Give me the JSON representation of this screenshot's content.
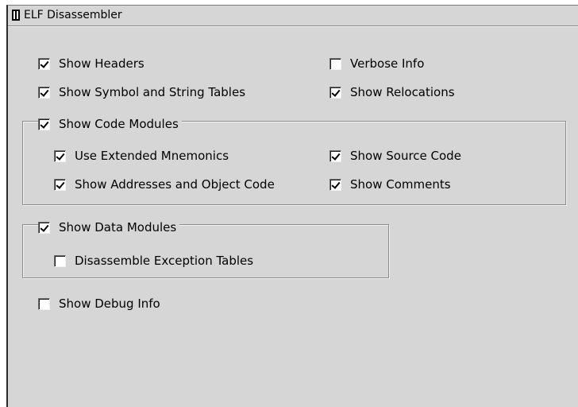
{
  "window": {
    "title": "ELF Disassembler"
  },
  "options": {
    "show_headers": {
      "label": "Show Headers",
      "checked": true
    },
    "verbose_info": {
      "label": "Verbose Info",
      "checked": false
    },
    "show_symbol_string_tables": {
      "label": "Show Symbol and String Tables",
      "checked": true
    },
    "show_relocations": {
      "label": "Show Relocations",
      "checked": true
    },
    "show_debug_info": {
      "label": "Show Debug Info",
      "checked": false
    }
  },
  "code_modules": {
    "label": "Show Code Modules",
    "checked": true,
    "use_extended_mnemonics": {
      "label": "Use Extended Mnemonics",
      "checked": true
    },
    "show_source_code": {
      "label": "Show Source Code",
      "checked": true
    },
    "show_addresses_object_code": {
      "label": "Show Addresses and Object Code",
      "checked": true
    },
    "show_comments": {
      "label": "Show Comments",
      "checked": true
    }
  },
  "data_modules": {
    "label": "Show Data Modules",
    "checked": true,
    "disassemble_exception_tables": {
      "label": "Disassemble Exception Tables",
      "checked": false
    }
  },
  "colors": {
    "background": "#d6d6d6",
    "text": "#000000",
    "checkbox_fill": "#ffffff"
  }
}
